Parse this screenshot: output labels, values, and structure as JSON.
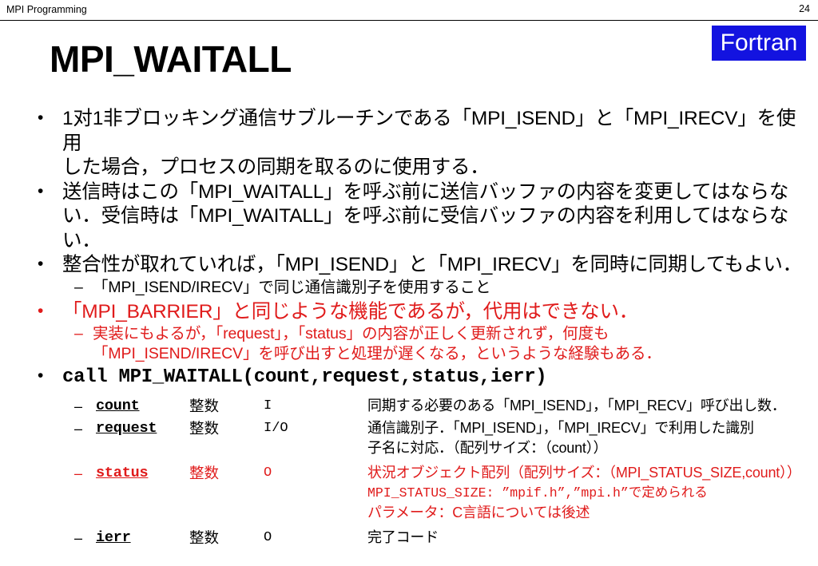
{
  "header": {
    "title": "MPI Programming",
    "page_number": "24"
  },
  "badge": {
    "label": "Fortran",
    "bg_color": "#1313E0",
    "text_color": "#FFFFFF"
  },
  "title": "MPI_WAITALL",
  "colors": {
    "red": "#E01B1B",
    "black": "#000000"
  },
  "bullets": {
    "b1_marker": "•",
    "b2_marker": "–",
    "item1_line1": "1对1非ブロッキング通信サブルーチンである「MPI_ISEND」と「MPI_IRECV」を使用",
    "item1_line2": "した場合，プロセスの同期を取るのに使用する．",
    "item2_line1": "送信時はこの「MPI_WAITALL」を呼ぶ前に送信バッファの内容を変更してはならな",
    "item2_line2": "い．受信時は「MPI_WAITALL」を呼ぶ前に受信バッファの内容を利用してはならない．",
    "item3": "整合性が取れていれば，「MPI_ISEND」と「MPI_IRECV」を同時に同期してもよい．",
    "item3_sub": "「MPI_ISEND/IRECV」で同じ通信識別子を使用すること",
    "item4": "「MPI_BARRIER」と同じような機能であるが，代用はできない．",
    "item4_sub_line1": "実装にもよるが，「request」，「status」の内容が正しく更新されず，何度も",
    "item4_sub_line2": "「MPI_ISEND/IRECV」を呼び出すと処理が遅くなる，というような経験もある．"
  },
  "signature": "call MPI_WAITALL(count,request,status,ierr)",
  "params": [
    {
      "name": "count",
      "type": "整数",
      "io": "I",
      "desc_lines": [
        {
          "text": "同期する必要のある「MPI_ISEND」，「MPI_RECV」呼び出し数．",
          "mono": false
        }
      ],
      "color": "#000000"
    },
    {
      "name": "request",
      "type": "整数",
      "io": "I/O",
      "desc_lines": [
        {
          "text": "通信識別子．「MPI_ISEND」，「MPI_IRECV」で利用した識別",
          "mono": false
        },
        {
          "text": "子名に対応．（配列サイズ：（count））",
          "mono": false
        }
      ],
      "color": "#000000"
    },
    {
      "name": "status",
      "type": "整数",
      "io": "O",
      "desc_lines": [
        {
          "text": "状況オブジェクト配列（配列サイズ：（MPI_STATUS_SIZE,count））",
          "mono": false
        },
        {
          "text": "MPI_STATUS_SIZE: ”mpif.h”,”mpi.h”で定められる",
          "mono": true
        },
        {
          "text": "パラメータ：C言語については後述",
          "mono": false
        }
      ],
      "color": "#E01B1B"
    },
    {
      "name": "ierr",
      "type": "整数",
      "io": "O",
      "desc_lines": [
        {
          "text": "完了コード",
          "mono": false
        }
      ],
      "color": "#000000"
    }
  ]
}
